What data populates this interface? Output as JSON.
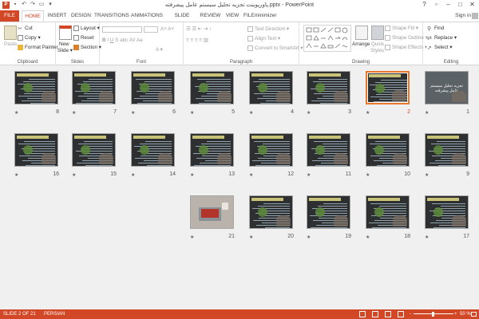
{
  "titlebar": {
    "title": "پاورپوینت تجزیه تحلیل سیستم عامل پیشرفته.pptx - PowerPoint",
    "app_icon": "P"
  },
  "tabs": [
    "FILE",
    "HOME",
    "INSERT",
    "DESIGN",
    "TRANSITIONS",
    "ANIMATIONS",
    "SLIDE SHOW",
    "REVIEW",
    "VIEW",
    "FILEminimizer"
  ],
  "active_tab": "HOME",
  "signin": "Sign in",
  "ribbon": {
    "clipboard": {
      "label": "Clipboard",
      "paste": "Paste",
      "cut": "Cut",
      "copy": "Copy",
      "format_painter": "Format Painter"
    },
    "slides": {
      "label": "Slides",
      "new_slide": "New",
      "new_slide2": "Slide",
      "layout": "Layout",
      "reset": "Reset",
      "section": "Section"
    },
    "font": {
      "label": "Font"
    },
    "paragraph": {
      "label": "Paragraph",
      "text_direction": "Text Direction",
      "align_text": "Align Text",
      "convert_smartart": "Convert to SmartArt"
    },
    "drawing": {
      "label": "Drawing",
      "arrange": "Arrange",
      "quick_styles": "Quick",
      "quick_styles2": "Styles",
      "shape_fill": "Shape Fill",
      "shape_outline": "Shape Outline",
      "shape_effects": "Shape Effects"
    },
    "editing": {
      "label": "Editing",
      "find": "Find",
      "replace": "Replace",
      "select": "Select"
    }
  },
  "slides": [
    {
      "num": "1",
      "kind": "title",
      "title_text": "تجزیه تحلیل سیستم عامل پیشرفته"
    },
    {
      "num": "2",
      "kind": "content",
      "selected": true
    },
    {
      "num": "3",
      "kind": "content"
    },
    {
      "num": "4",
      "kind": "content"
    },
    {
      "num": "5",
      "kind": "content"
    },
    {
      "num": "6",
      "kind": "content"
    },
    {
      "num": "7",
      "kind": "content"
    },
    {
      "num": "8",
      "kind": "content"
    },
    {
      "num": "9",
      "kind": "content"
    },
    {
      "num": "10",
      "kind": "content"
    },
    {
      "num": "11",
      "kind": "content"
    },
    {
      "num": "12",
      "kind": "content"
    },
    {
      "num": "13",
      "kind": "content"
    },
    {
      "num": "14",
      "kind": "content"
    },
    {
      "num": "15",
      "kind": "content"
    },
    {
      "num": "16",
      "kind": "content"
    },
    {
      "num": "17",
      "kind": "content"
    },
    {
      "num": "18",
      "kind": "content"
    },
    {
      "num": "19",
      "kind": "content"
    },
    {
      "num": "20",
      "kind": "content"
    },
    {
      "num": "21",
      "kind": "photo"
    }
  ],
  "statusbar": {
    "slide_info": "SLIDE 2 OF 21",
    "language": "PERSIAN",
    "zoom": "50 %",
    "zoom_minus": "-",
    "zoom_plus": "+"
  },
  "colors": {
    "accent": "#d24726",
    "selection": "#e8762b"
  }
}
